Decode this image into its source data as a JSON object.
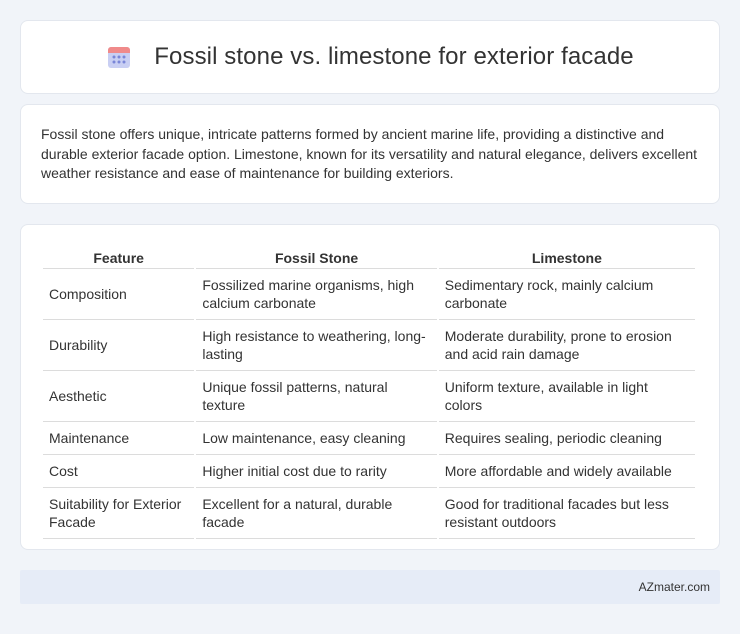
{
  "header": {
    "title": "Fossil stone vs. limestone for exterior facade",
    "icon": "calendar-icon"
  },
  "intro": {
    "text": "Fossil stone offers unique, intricate patterns formed by ancient marine life, providing a distinctive and durable exterior facade option. Limestone, known for its versatility and natural elegance, delivers excellent weather resistance and ease of maintenance for building exteriors."
  },
  "table": {
    "headers": [
      "Feature",
      "Fossil Stone",
      "Limestone"
    ],
    "rows": [
      [
        "Composition",
        "Fossilized marine organisms, high calcium carbonate",
        "Sedimentary rock, mainly calcium carbonate"
      ],
      [
        "Durability",
        "High resistance to weathering, long-lasting",
        "Moderate durability, prone to erosion and acid rain damage"
      ],
      [
        "Aesthetic",
        "Unique fossil patterns, natural texture",
        "Uniform texture, available in light colors"
      ],
      [
        "Maintenance",
        "Low maintenance, easy cleaning",
        "Requires sealing, periodic cleaning"
      ],
      [
        "Cost",
        "Higher initial cost due to rarity",
        "More affordable and widely available"
      ],
      [
        "Suitability for Exterior Facade",
        "Excellent for a natural, durable facade",
        "Good for traditional facades but less resistant outdoors"
      ]
    ]
  },
  "footer": {
    "text": "AZmater.com"
  },
  "colors": {
    "accent": "#6b7fd7",
    "icon_top": "#f08a8a",
    "icon_body": "#c9cff3"
  }
}
